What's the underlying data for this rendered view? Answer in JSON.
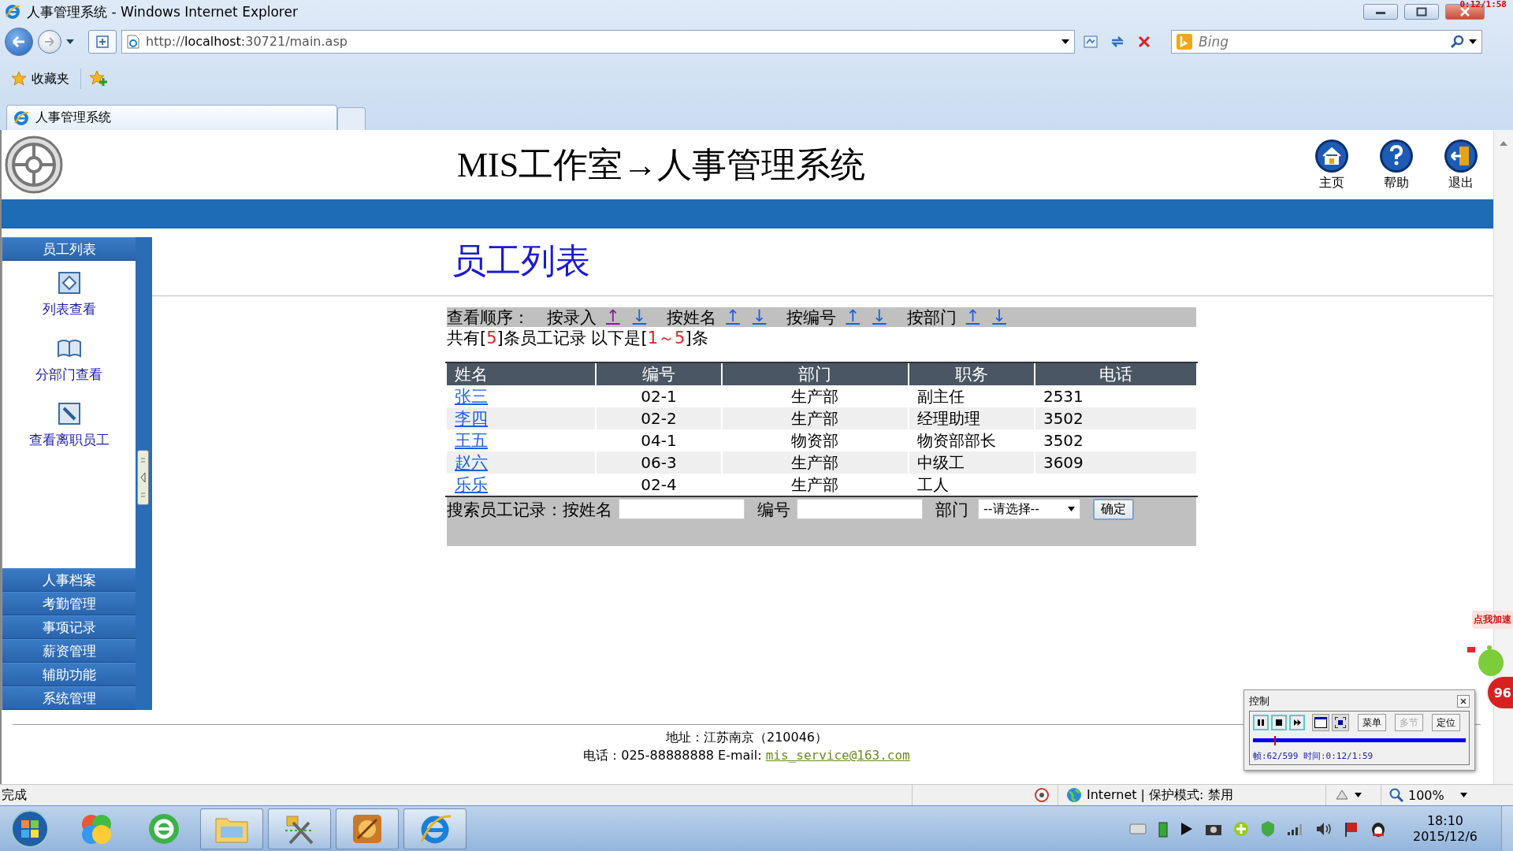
{
  "window": {
    "title": "人事管理系统 - Windows Internet Explorer",
    "recorder_time": "0:12/1:58"
  },
  "address_bar": {
    "url": "http://**localhost**:30721/main.asp"
  },
  "search": {
    "placeholder": "Bing"
  },
  "favorites": {
    "label": "收藏夹"
  },
  "tabs": [
    {
      "label": "人事管理系统",
      "selected": true
    }
  ],
  "header": {
    "title": "MIS工作室→人事管理系统",
    "buttons": [
      {
        "kind": "home",
        "label": "主页"
      },
      {
        "kind": "help",
        "label": "帮助"
      },
      {
        "kind": "exit",
        "label": "退出"
      }
    ]
  },
  "sidebar": {
    "sections": [
      {
        "label": "员工列表",
        "items": [
          {
            "kind": "list",
            "label": "列表查看"
          },
          {
            "kind": "book",
            "label": "分部门查看"
          },
          {
            "kind": "edit",
            "label": "查看离职员工"
          }
        ]
      },
      {
        "label": "人事档案"
      },
      {
        "label": "考勤管理"
      },
      {
        "label": "事项记录"
      },
      {
        "label": "薪资管理"
      },
      {
        "label": "辅助功能"
      },
      {
        "label": "系统管理"
      }
    ]
  },
  "content": {
    "title": "员工列表",
    "sort": {
      "label": "查看顺序：",
      "options": [
        {
          "label": "按录入",
          "arrows": [
            {
              "text": "↑",
              "visited": true
            },
            {
              "text": "↓",
              "visited": false
            }
          ]
        },
        {
          "label": "按姓名",
          "arrows": [
            {
              "text": "↑",
              "visited": false
            },
            {
              "text": "↓",
              "visited": false
            }
          ]
        },
        {
          "label": "按编号",
          "arrows": [
            {
              "text": "↑",
              "visited": false
            },
            {
              "text": "↓",
              "visited": false
            }
          ]
        },
        {
          "label": "按部门",
          "arrows": [
            {
              "text": "↑",
              "visited": false
            },
            {
              "text": "↓",
              "visited": false
            }
          ]
        }
      ]
    },
    "count": {
      "prefix": "共有[",
      "total": "5",
      "middle": "]条员工记录 以下是[",
      "range": "1～5",
      "suffix": "]条"
    },
    "table": {
      "columns": [
        "姓名",
        "编号",
        "部门",
        "职务",
        "电话"
      ],
      "rows": [
        {
          "name": "张三",
          "id": "02-1",
          "dept": "生产部",
          "position": "副主任",
          "phone": "2531"
        },
        {
          "name": "李四",
          "id": "02-2",
          "dept": "生产部",
          "position": "经理助理",
          "phone": "3502"
        },
        {
          "name": "王五",
          "id": "04-1",
          "dept": "物资部",
          "position": "物资部部长",
          "phone": "3502"
        },
        {
          "name": "赵六",
          "id": "06-3",
          "dept": "生产部",
          "position": "中级工",
          "phone": "3609"
        },
        {
          "name": "乐乐",
          "id": "02-4",
          "dept": "生产部",
          "position": "工人"
        }
      ]
    },
    "search": {
      "label": "搜索员工记录：按姓名",
      "id_label": "编号",
      "dept_label": "部门",
      "dept_select": "--请选择--",
      "submit": "确定"
    }
  },
  "footer": {
    "address": "地址：江苏南京（210046）",
    "contact": "电话：025-88888888 E-mail: ",
    "email": "mis_service@163.com"
  },
  "status_bar": {
    "text": "完成",
    "zone": "Internet | 保护模式: 禁用",
    "zoom": "100%"
  },
  "taskbar": {
    "time": "18:10",
    "date": "2015/12/6"
  },
  "control_panel": {
    "title": "控制",
    "buttons": [
      {
        "label": "菜单",
        "disabled": false
      },
      {
        "label": "多节",
        "disabled": true
      },
      {
        "label": "定位",
        "disabled": false
      }
    ],
    "progress": {
      "level": 0.1
    },
    "status": "帧:62/599 时间:0:12/1:59"
  },
  "ad": {
    "bubble": "点我加速",
    "badge": "96"
  }
}
